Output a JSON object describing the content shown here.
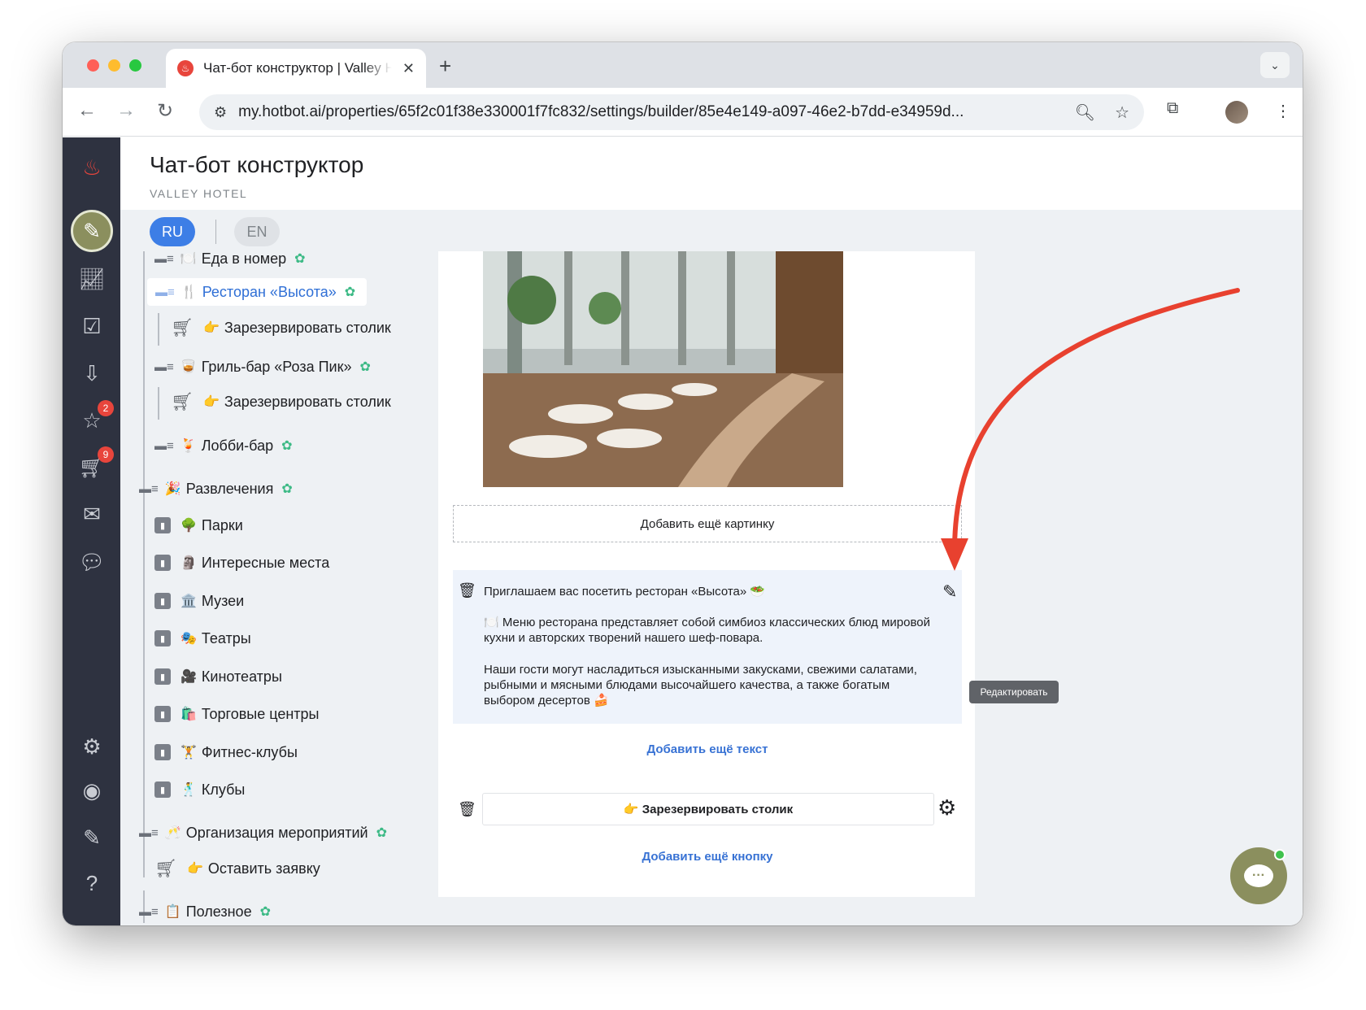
{
  "browser": {
    "tab_title": "Чат-бот конструктор | Valley Hotel",
    "tab_close": "✕",
    "new_tab": "+",
    "url": "my.hotbot.ai/properties/65f2c01f38e330001f7fc832/settings/builder/85e4e149-a097-46e2-b7dd-e34959d...",
    "icons": [
      "back-icon",
      "forward-icon",
      "reload-icon",
      "site-settings-icon",
      "zoom-icon",
      "bookmark-star-icon",
      "extensions-icon",
      "profile-avatar",
      "menu-kebab-icon"
    ]
  },
  "sidebar": {
    "badges": {
      "reviews": "2",
      "orders": "9"
    }
  },
  "header": {
    "title": "Чат-бот конструктор",
    "subtitle": "VALLEY HOTEL"
  },
  "languages": {
    "ru": "RU",
    "en": "EN",
    "active": "RU"
  },
  "tree": {
    "items": [
      {
        "label": "Еда в номер",
        "emoji": "🍽️"
      },
      {
        "label": "Ресторан «Высота»",
        "emoji": "🍴",
        "selected": true
      },
      {
        "label": "Зарезервировать столик",
        "emoji": "👉"
      },
      {
        "label": "Гриль-бар «Роза Пик»",
        "emoji": "🥃"
      },
      {
        "label": "Зарезервировать столик",
        "emoji": "👉"
      },
      {
        "label": "Лобби-бар",
        "emoji": "🍹"
      },
      {
        "label": "Развлечения",
        "emoji": "🎉"
      },
      {
        "label": "Парки",
        "emoji": "🌳"
      },
      {
        "label": "Интересные места",
        "emoji": "🗿"
      },
      {
        "label": "Музеи",
        "emoji": "🏛️"
      },
      {
        "label": "Театры",
        "emoji": "🎭"
      },
      {
        "label": "Кинотеатры",
        "emoji": "🎥"
      },
      {
        "label": "Торговые центры",
        "emoji": "🛍️"
      },
      {
        "label": "Фитнес-клубы",
        "emoji": "🏋️"
      },
      {
        "label": "Клубы",
        "emoji": "🕺"
      },
      {
        "label": "Организация мероприятий",
        "emoji": "🥂"
      },
      {
        "label": "Оставить заявку",
        "emoji": "👉"
      },
      {
        "label": "Полезное",
        "emoji": "📋"
      }
    ]
  },
  "editor": {
    "add_image": "Добавить ещё картинку",
    "text_title": "Приглашаем вас посетить ресторан «Высота» 🥗",
    "text_p1": "🍽️ Меню ресторана представляет собой симбиоз классических блюд мировой кухни и авторских творений нашего шеф-повара.",
    "text_p2": "Наши гости могут насладиться изысканными закусками, свежими салатами, рыбными и мясными блюдами высочайшего качества, а также богатым выбором десертов 🍰",
    "add_text": "Добавить ещё текст",
    "button_label": "👉 Зарезервировать столик",
    "add_button": "Добавить ещё кнопку",
    "tooltip": "Редактировать"
  },
  "colors": {
    "accent": "#3d7ee6",
    "sidebar": "#2e3240",
    "brand_olive": "#8b8f5e",
    "annotation_arrow": "#e8412f"
  }
}
